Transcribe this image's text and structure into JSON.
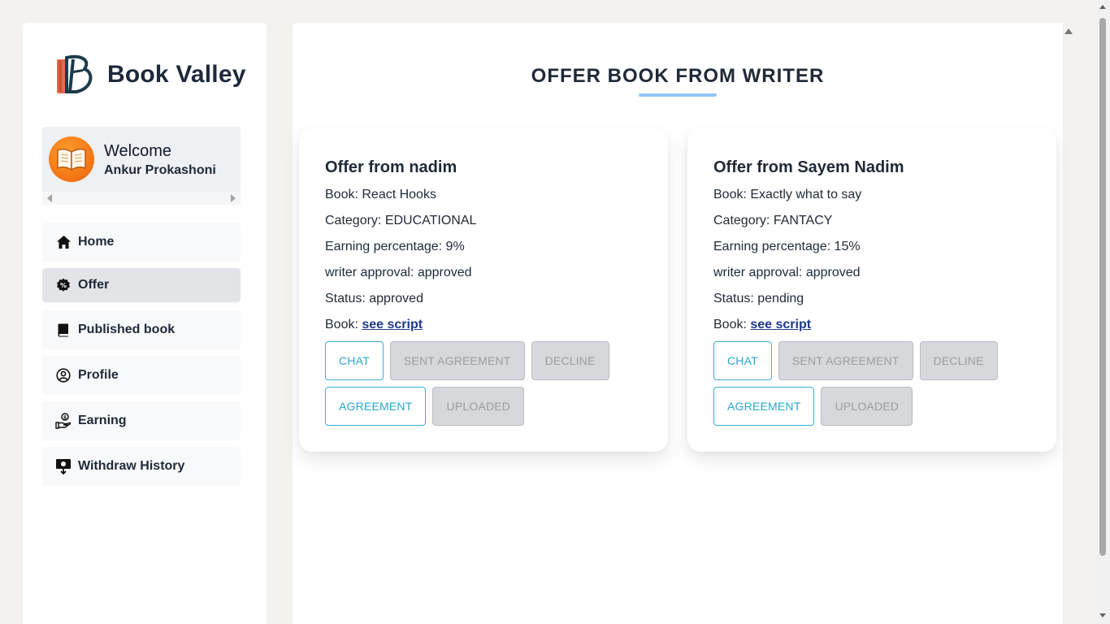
{
  "brand": {
    "name": "Book Valley",
    "logo_icon": "book-valley-logo-icon"
  },
  "welcome": {
    "title": "Welcome",
    "user": "Ankur Prokashoni",
    "avatar_icon": "open-book-icon"
  },
  "nav": {
    "items": [
      {
        "label": "Home",
        "icon": "home-icon"
      },
      {
        "label": "Offer",
        "icon": "percent-badge-icon",
        "active": true
      },
      {
        "label": "Published book",
        "icon": "book-icon"
      },
      {
        "label": "Profile",
        "icon": "user-circle-icon"
      },
      {
        "label": "Earning",
        "icon": "hand-coin-icon"
      },
      {
        "label": "Withdraw History",
        "icon": "withdraw-icon"
      }
    ]
  },
  "main": {
    "title": "OFFER BOOK FROM WRITER",
    "accent": "#93c5fd",
    "offers": [
      {
        "title": "Offer from nadim",
        "book": "Book: React Hooks",
        "category": "Category: EDUCATIONAL",
        "earning": "Earning percentage: 9%",
        "writer_approval": "writer approval: approved",
        "status": "Status: approved",
        "script_prefix": "Book: ",
        "script_link": "see script",
        "buttons": {
          "chat": "CHAT",
          "sent_agreement": "SENT AGREEMENT",
          "decline": "DECLINE",
          "agreement": "AGREEMENT",
          "uploaded": "UPLOADED"
        }
      },
      {
        "title": "Offer from Sayem Nadim",
        "book": "Book: Exactly what to say",
        "category": "Category: FANTACY",
        "earning": "Earning percentage: 15%",
        "writer_approval": "writer approval: approved",
        "status": "Status: pending",
        "script_prefix": "Book: ",
        "script_link": "see script",
        "buttons": {
          "chat": "CHAT",
          "sent_agreement": "SENT AGREEMENT",
          "decline": "DECLINE",
          "agreement": "AGREEMENT",
          "uploaded": "UPLOADED"
        }
      }
    ]
  },
  "colors": {
    "button_outline": "#38b2d6",
    "button_disabled": "#d6d8dc",
    "link": "#1e3a8a",
    "page_bg": "#f3f2ee"
  }
}
